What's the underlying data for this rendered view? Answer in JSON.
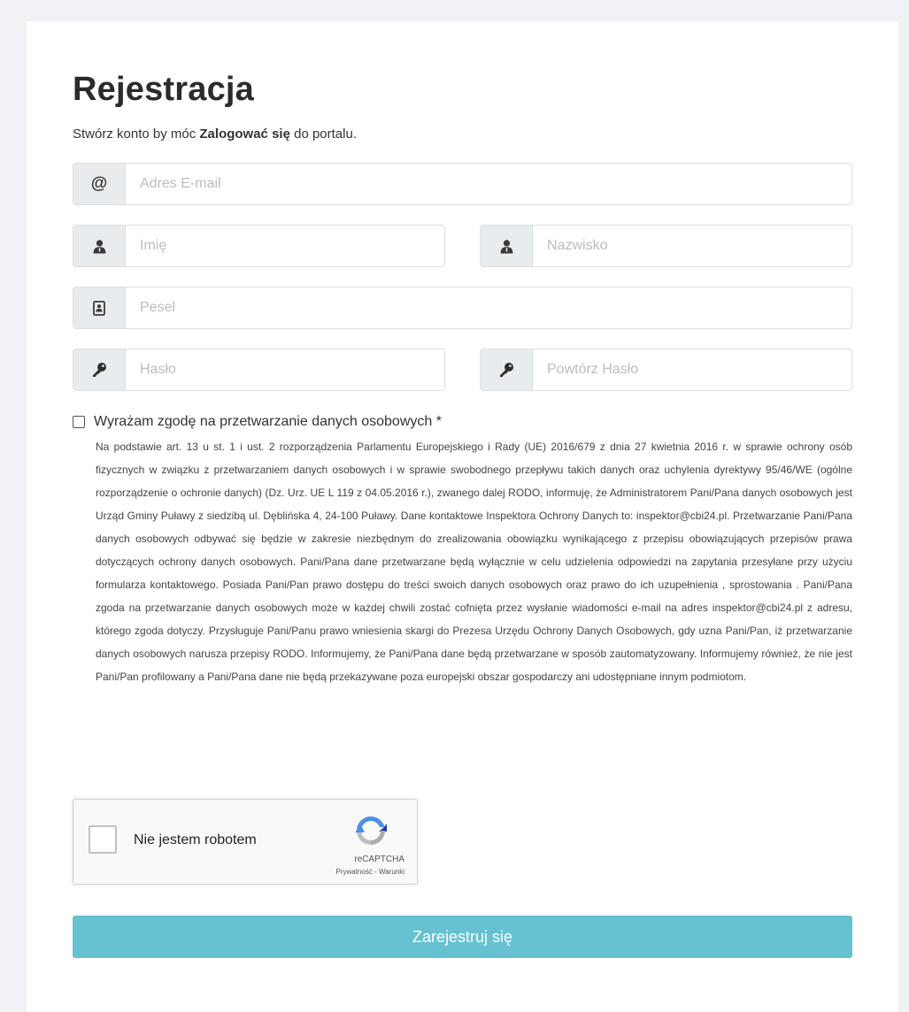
{
  "page": {
    "title": "Rejestracja",
    "subtitle_prefix": "Stwórz konto by móc ",
    "subtitle_bold": "Zalogować się",
    "subtitle_suffix": " do portalu."
  },
  "form": {
    "email": {
      "icon": "at-icon",
      "glyph": "@",
      "placeholder": "Adres E-mail",
      "value": ""
    },
    "first_name": {
      "icon": "user-icon",
      "placeholder": "Imię",
      "value": ""
    },
    "last_name": {
      "icon": "user-icon",
      "placeholder": "Nazwisko",
      "value": ""
    },
    "pesel": {
      "icon": "id-card-icon",
      "placeholder": "Pesel",
      "value": ""
    },
    "password": {
      "icon": "key-icon",
      "placeholder": "Hasło",
      "value": ""
    },
    "password_repeat": {
      "icon": "key-icon",
      "placeholder": "Powtórz Hasło",
      "value": ""
    }
  },
  "consent": {
    "checked": false,
    "label": "Wyrażam zgodę na przetwarzanie danych osobowych *",
    "text": "Na podstawie art. 13 u st. 1 i ust. 2 rozporządzenia Parlamentu Europejskiego i Rady (UE) 2016/679 z dnia 27 kwietnia 2016 r. w sprawie ochrony osób fizycznych w związku z przetwarzaniem danych osobowych i w sprawie swobodnego przepływu takich danych oraz uchylenia dyrektywy 95/46/WE (ogólne rozporządzenie o ochronie danych) (Dz. Urz. UE L 119 z 04.05.2016 r.), zwanego dalej RODO, informuję, że Administratorem Pani/Pana danych osobowych jest Urząd Gminy Puławy z siedzibą ul. Dęblińska 4, 24-100 Puławy. Dane kontaktowe Inspektora Ochrony Danych to: inspektor@cbi24.pl. Przetwarzanie Pani/Pana danych osobowych odbywać się będzie w zakresie niezbędnym do zrealizowania obowiązku wynikającego z przepisu obowiązujących przepisów prawa dotyczących ochrony danych osobowych. Pani/Pana dane przetwarzane będą wyłącznie w celu udzielenia odpowiedzi na zapytania przesyłane przy użyciu formularza kontaktowego. Posiada Pani/Pan prawo dostępu do treści swoich danych osobowych oraz prawo do ich uzupełnienia , sprostowania . Pani/Pana zgoda na przetwarzanie danych osobowych może w każdej chwili zostać cofnięta przez wysłanie wiadomości e-mail na adres inspektor@cbi24.pl z adresu, którego zgoda dotyczy. Przysługuje Pani/Panu prawo wniesienia skargi do Prezesa Urzędu Ochrony Danych Osobowych, gdy uzna Pani/Pan, iż przetwarzanie danych osobowych narusza przepisy RODO. Informujemy, że Pani/Pana dane będą przetwarzane w sposób zautomatyzowany. Informujemy również, że nie jest Pani/Pan profilowany a Pani/Pana dane nie będą przekazywane poza europejski obszar gospodarczy ani udostępniane innym podmiotom."
  },
  "captcha": {
    "label": "Nie jestem robotem",
    "brand": "reCAPTCHA",
    "privacy": "Prywatność",
    "separator": " - ",
    "terms": "Warunki"
  },
  "submit": {
    "label": "Zarejestruj się"
  },
  "colors": {
    "background": "#f1f2f5",
    "addon": "#e9ecef",
    "border": "#dcdfe3",
    "button": "#66c1d1",
    "placeholder": "#b9bcc0"
  }
}
